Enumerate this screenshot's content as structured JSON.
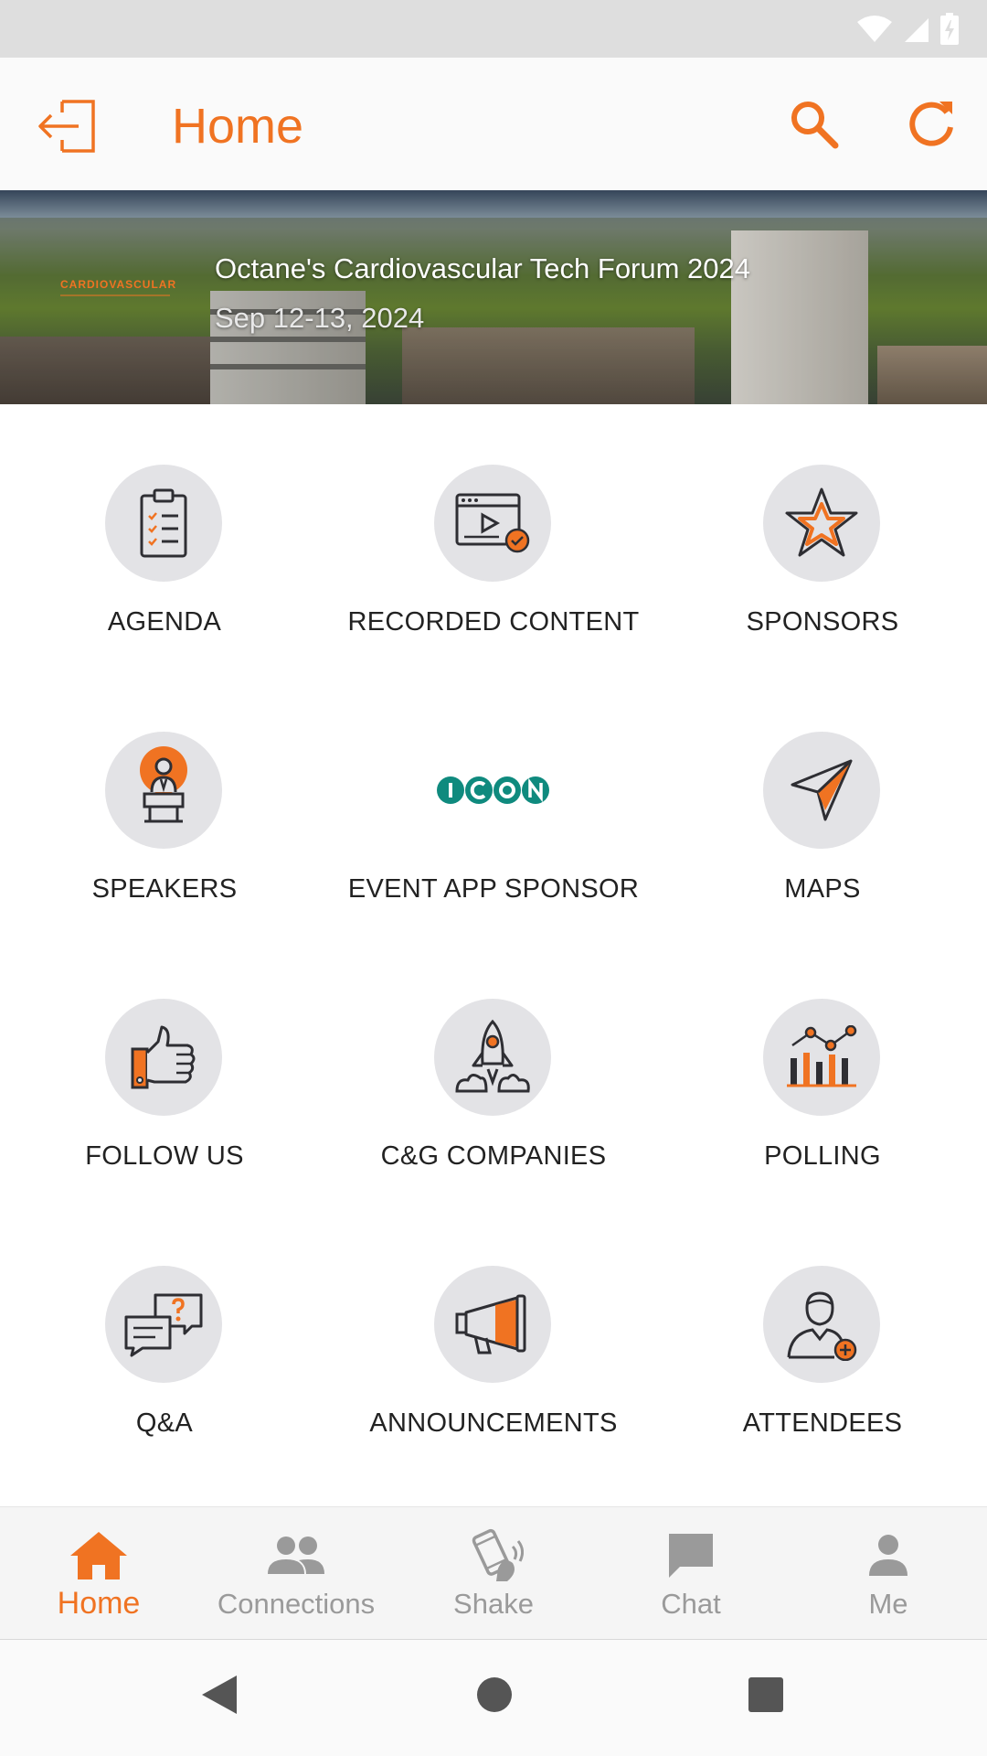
{
  "app_bar": {
    "title": "Home"
  },
  "banner": {
    "logo_text": "CARDIOVASCULAR",
    "event_title": "Octane's Cardiovascular Tech Forum 2024",
    "event_date": "Sep 12-13, 2024"
  },
  "grid": {
    "items": [
      {
        "label": "AGENDA",
        "icon": "clipboard-checklist-icon"
      },
      {
        "label": "RECORDED CONTENT",
        "icon": "video-player-icon"
      },
      {
        "label": "SPONSORS",
        "icon": "star-icon"
      },
      {
        "label": "SPEAKERS",
        "icon": "speaker-podium-icon"
      },
      {
        "label": "EVENT APP SPONSOR",
        "icon": "icon-logo",
        "logo_text": "ICON"
      },
      {
        "label": "MAPS",
        "icon": "paper-plane-icon"
      },
      {
        "label": "FOLLOW US",
        "icon": "thumbs-up-icon"
      },
      {
        "label": "C&G COMPANIES",
        "icon": "rocket-icon"
      },
      {
        "label": "POLLING",
        "icon": "bar-chart-icon"
      },
      {
        "label": "Q&A",
        "icon": "chat-question-icon"
      },
      {
        "label": "ANNOUNCEMENTS",
        "icon": "megaphone-icon"
      },
      {
        "label": "ATTENDEES",
        "icon": "person-add-icon"
      }
    ]
  },
  "bottom_nav": {
    "items": [
      {
        "label": "Home",
        "icon": "home-icon",
        "active": true
      },
      {
        "label": "Connections",
        "icon": "people-icon",
        "active": false
      },
      {
        "label": "Shake",
        "icon": "shake-phone-icon",
        "active": false
      },
      {
        "label": "Chat",
        "icon": "chat-bubble-icon",
        "active": false
      },
      {
        "label": "Me",
        "icon": "person-icon",
        "active": false
      }
    ]
  },
  "colors": {
    "accent": "#f07322",
    "icon_circle": "#e3e3e6",
    "inactive_nav": "#9a9a9a",
    "icon_logo_teal": "#0f8a7e"
  }
}
